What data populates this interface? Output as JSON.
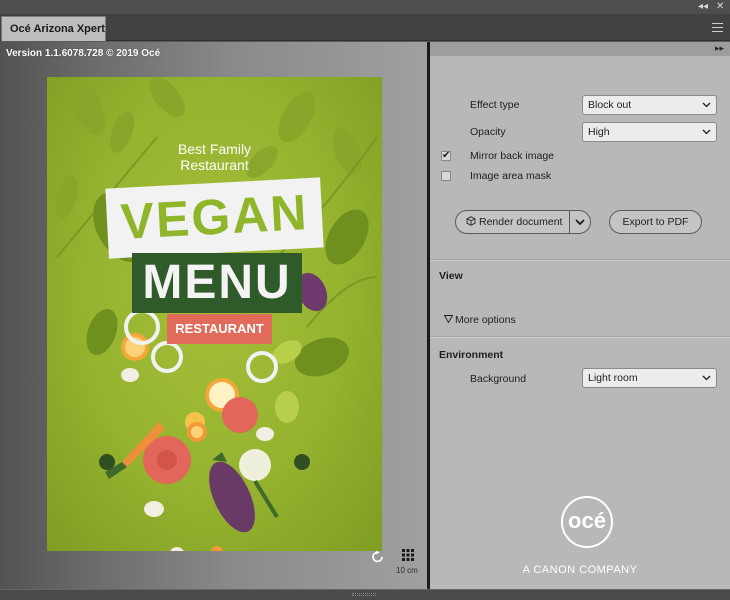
{
  "window": {
    "collapse_glyph": "◂◂",
    "close_glyph": "✕",
    "tab_label": "Océ Arizona Xpert",
    "menu_icon": "hamburger-icon"
  },
  "preview": {
    "version_text": "Version 1.1.6078.728 © 2019 Océ",
    "poster": {
      "line1": "Best Family",
      "line2": "Restaurant",
      "title_top": "VEGAN",
      "title_bottom": "MENU",
      "subtitle": "RESTAURANT"
    },
    "scale_label": "10 cm",
    "rotate_icon": "rotate-icon",
    "grid_icon": "grid-icon"
  },
  "panel": {
    "expand_glyph": "▸▸",
    "effect_type": {
      "label": "Effect type",
      "value": "Block out"
    },
    "opacity": {
      "label": "Opacity",
      "value": "High"
    },
    "mirror_back_image": {
      "label": "Mirror back image",
      "checked": true
    },
    "image_area_mask": {
      "label": "Image area mask",
      "checked": false
    },
    "render_button": "Render document",
    "export_button": "Export to PDF",
    "view_section": {
      "title": "View",
      "more_options": "More options"
    },
    "environment_section": {
      "title": "Environment",
      "background": {
        "label": "Background",
        "value": "Light room"
      }
    },
    "logo": {
      "mark": "océ",
      "tagline": "A CANON COMPANY"
    }
  }
}
